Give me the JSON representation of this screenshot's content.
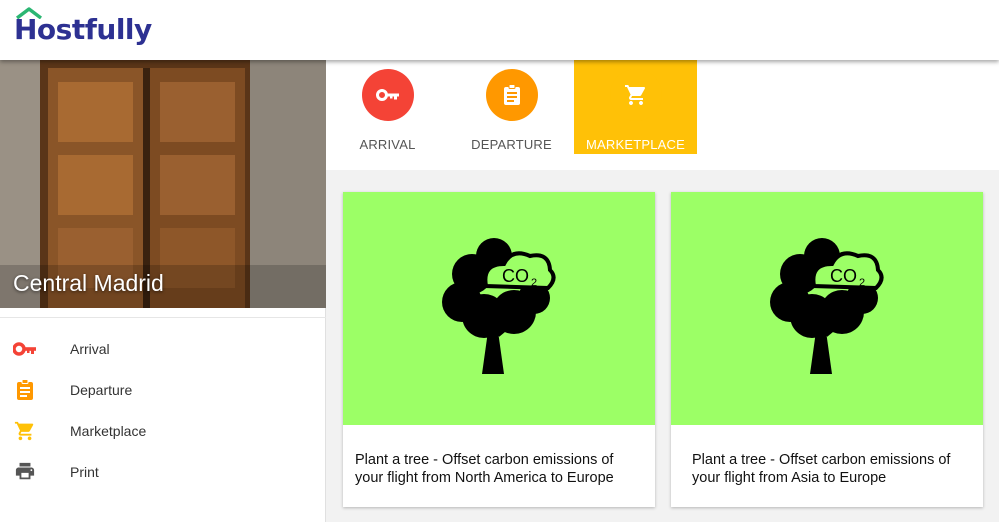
{
  "header": {
    "brand": "Hostfully"
  },
  "sidebar": {
    "title": "Central Madrid",
    "items": [
      {
        "label": "Arrival",
        "icon": "key-icon",
        "color": "#f44336"
      },
      {
        "label": "Departure",
        "icon": "clipboard-icon",
        "color": "#ff9800"
      },
      {
        "label": "Marketplace",
        "icon": "cart-icon",
        "color": "#ffc107"
      },
      {
        "label": "Print",
        "icon": "printer-icon",
        "color": "#555555"
      }
    ]
  },
  "tabs": [
    {
      "label": "ARRIVAL",
      "icon": "key-icon",
      "color": "#f44336",
      "active": false
    },
    {
      "label": "DEPARTURE",
      "icon": "clipboard-icon",
      "color": "#ff9800",
      "active": false
    },
    {
      "label": "MARKETPLACE",
      "icon": "cart-icon",
      "color": "#ffc107",
      "active": true
    }
  ],
  "cards": [
    {
      "title": "Plant a tree - Offset carbon emissions of your flight from North America to Europe",
      "image_icon": "co2-tree-icon",
      "image_bg": "#9cff66"
    },
    {
      "title": "Plant a tree - Offset carbon emissions of your flight from Asia to Europe",
      "image_icon": "co2-tree-icon",
      "image_bg": "#9cff66"
    }
  ],
  "colors": {
    "brand": "#2d3192",
    "accent_green": "#2bb673",
    "active_tab": "#ffc107"
  }
}
